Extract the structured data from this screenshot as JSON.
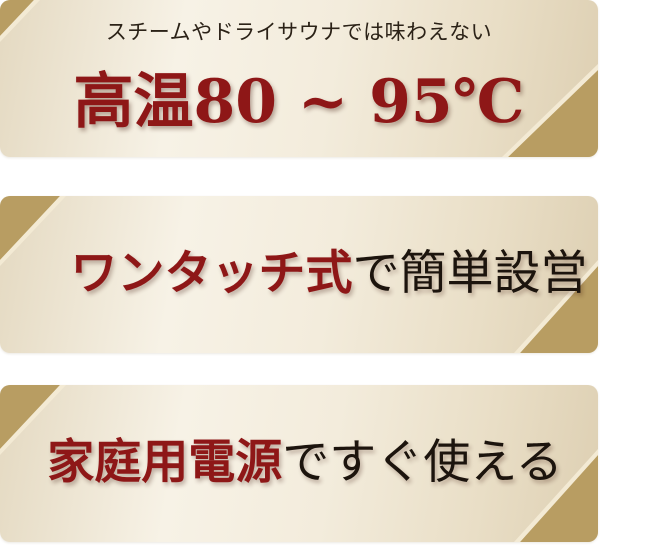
{
  "banners": [
    {
      "subtitle": "スチームやドライサウナでは味わえない",
      "headline": "高温80 ~ 95℃"
    },
    {
      "highlight": "ワンタッチ式",
      "rest": "で簡単設営"
    },
    {
      "highlight": "家庭用電源",
      "rest": "ですぐ使える"
    }
  ],
  "colors": {
    "accent_red": "#8e1717",
    "text_dark": "#1c140d",
    "gold_corner": "#b89d62",
    "panel_light": "#f5efe2"
  }
}
